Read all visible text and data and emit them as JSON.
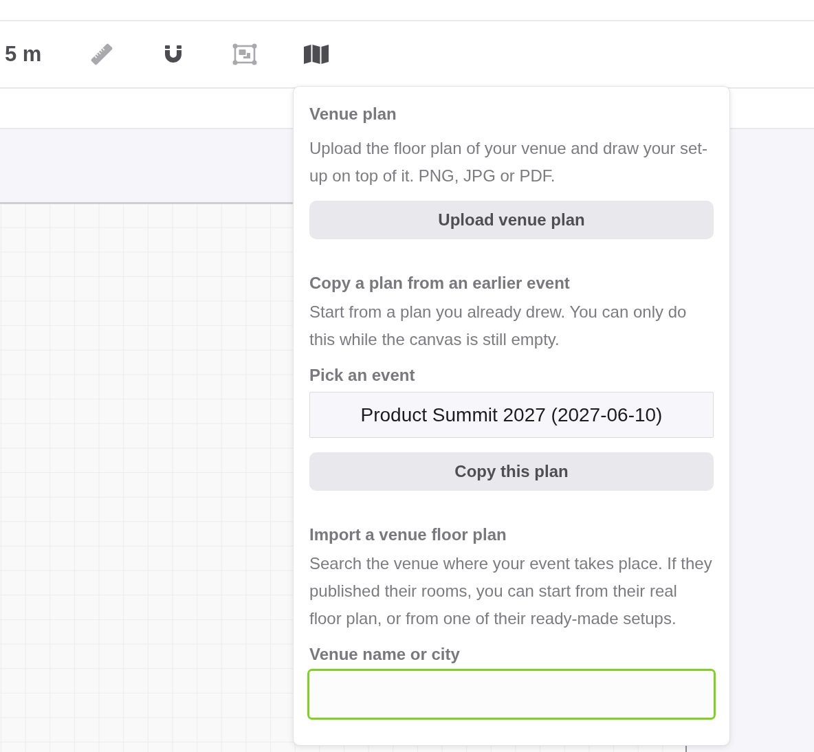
{
  "toolbar": {
    "scale_label": "5 m",
    "tools": [
      {
        "kind": "ruler",
        "active": false
      },
      {
        "kind": "magnet",
        "active": true
      },
      {
        "kind": "frame",
        "active": false
      },
      {
        "kind": "map",
        "active": true
      }
    ]
  },
  "venue_plan_popover": {
    "sections": [
      {
        "heading": "Venue plan",
        "text": "Upload the floor plan of your venue and draw your set-up on top of it. PNG, JPG or PDF.",
        "button": "Upload venue plan"
      },
      {
        "heading": "Copy a plan from an earlier event",
        "text": "Start from a plan you already drew. You can only do this while the canvas is still empty.",
        "field_label": "Pick an event",
        "select_value": "Product Summit 2027 (2027-06-10)",
        "button": "Copy this plan"
      },
      {
        "heading": "Import a venue floor plan",
        "text": "Search the venue where your event takes place. If they published their rooms, you can start from their real floor plan, or from one of their ready-made setups.",
        "field_label": "Venue name or city",
        "search_field": {
          "focused": true
        }
      }
    ]
  }
}
